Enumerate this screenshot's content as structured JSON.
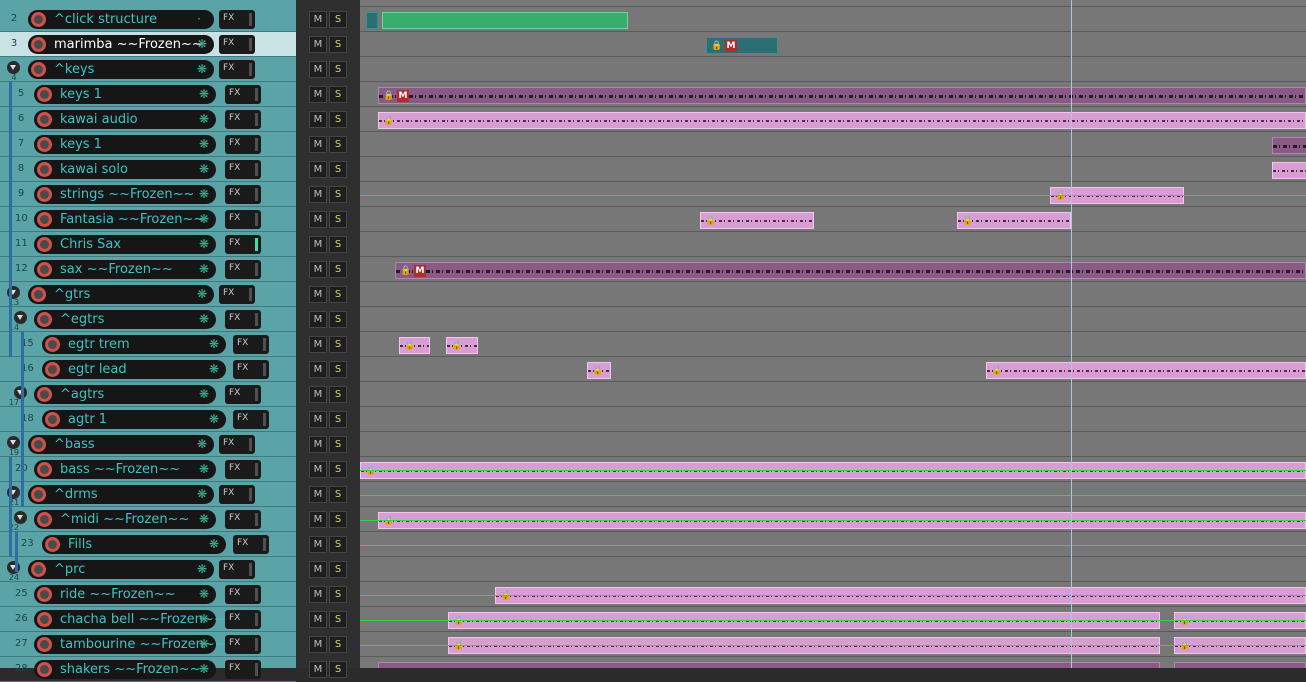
{
  "colors": {
    "tcp_bg": "#5aa3a6",
    "track_name": "#3ec3c4",
    "selected_bg": "#c9e2e4",
    "clip_pink": "#d89ed4",
    "clip_dark": "#8a5a86",
    "mute_badge": "#b12c2c",
    "fx_active": "#3be39d",
    "envelope": "#34d34a"
  },
  "fx_label": "FX",
  "mute_label": "M",
  "solo_label": "S",
  "tracks": [
    {
      "num": "2",
      "name": "^click structure",
      "meter": "·"
    },
    {
      "num": "3",
      "name": "marimba ~~Frozen~~",
      "meter": "❋"
    },
    {
      "num": "4",
      "name": "^keys",
      "meter": "❋"
    },
    {
      "num": "5",
      "name": "keys 1",
      "meter": "❋"
    },
    {
      "num": "6",
      "name": "kawai audio",
      "meter": "❋"
    },
    {
      "num": "7",
      "name": "keys 1",
      "meter": "❋"
    },
    {
      "num": "8",
      "name": "kawai solo",
      "meter": "❋"
    },
    {
      "num": "9",
      "name": "strings ~~Frozen~~",
      "meter": "❋"
    },
    {
      "num": "10",
      "name": "Fantasia  ~~Frozen~~",
      "meter": "❋"
    },
    {
      "num": "11",
      "name": "Chris Sax",
      "meter": "❋"
    },
    {
      "num": "12",
      "name": "sax ~~Frozen~~",
      "meter": "❋"
    },
    {
      "num": "13",
      "name": "^gtrs",
      "meter": "❋"
    },
    {
      "num": "14",
      "name": "^egtrs",
      "meter": "❋"
    },
    {
      "num": "15",
      "name": "egtr trem",
      "meter": "❋"
    },
    {
      "num": "16",
      "name": "egtr  lead",
      "meter": "❋"
    },
    {
      "num": "17",
      "name": "^agtrs",
      "meter": "❋"
    },
    {
      "num": "18",
      "name": "agtr 1",
      "meter": "❋"
    },
    {
      "num": "19",
      "name": "^bass",
      "meter": "❋"
    },
    {
      "num": "20",
      "name": "bass ~~Frozen~~",
      "meter": "❋"
    },
    {
      "num": "21",
      "name": "^drms",
      "meter": "❋"
    },
    {
      "num": "22",
      "name": "^midi  ~~Frozen~~",
      "meter": "❋"
    },
    {
      "num": "23",
      "name": "Fills",
      "meter": "❋"
    },
    {
      "num": "24",
      "name": "^prc",
      "meter": "❋"
    },
    {
      "num": "25",
      "name": "ride ~~Frozen~~",
      "meter": "❋"
    },
    {
      "num": "26",
      "name": "chacha bell ~~Frozen~~",
      "meter": "❋"
    },
    {
      "num": "27",
      "name": "tambourine  ~~Frozen~~",
      "meter": "❋"
    },
    {
      "num": "28",
      "name": "shakers ~~Frozen~~",
      "meter": "❋"
    }
  ]
}
